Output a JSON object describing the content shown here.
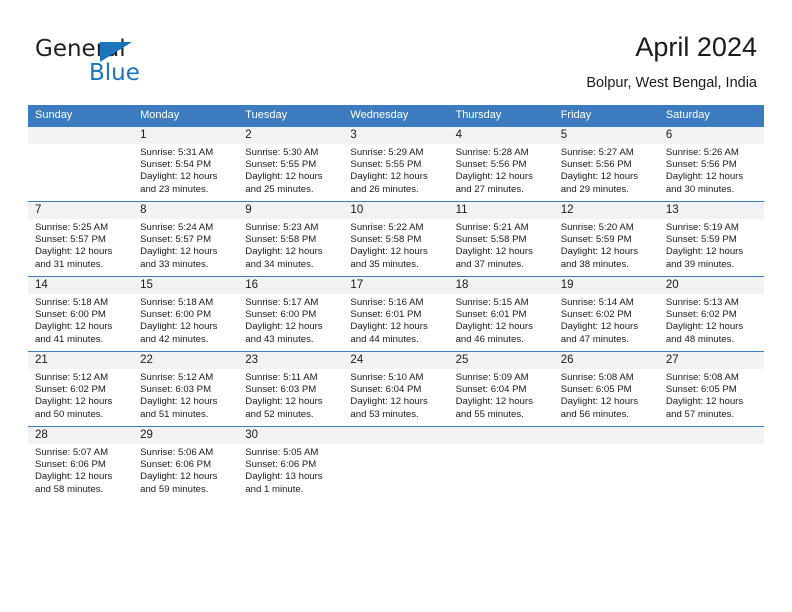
{
  "logo": {
    "word_one": "General",
    "word_two": "Blue",
    "triangle_color": "#1b75bb",
    "text_color": "#231f20"
  },
  "header": {
    "title": "April 2024",
    "subtitle": "Bolpur, West Bengal, India"
  },
  "theme": {
    "header_blue": "#3c7cbe",
    "daynum_band": "#f2f2f2",
    "text": "#1a1a1a"
  },
  "weekday_headers": [
    "Sunday",
    "Monday",
    "Tuesday",
    "Wednesday",
    "Thursday",
    "Friday",
    "Saturday"
  ],
  "labels": {
    "sunrise_prefix": "Sunrise:",
    "sunset_prefix": "Sunset:",
    "daylight_prefix": "Daylight:"
  },
  "weeks": [
    [
      {
        "day": "",
        "sunrise": "",
        "sunset": "",
        "daylight_line1": "",
        "daylight_line2": ""
      },
      {
        "day": "1",
        "sunrise": "Sunrise: 5:31 AM",
        "sunset": "Sunset: 5:54 PM",
        "daylight_line1": "Daylight: 12 hours",
        "daylight_line2": "and 23 minutes."
      },
      {
        "day": "2",
        "sunrise": "Sunrise: 5:30 AM",
        "sunset": "Sunset: 5:55 PM",
        "daylight_line1": "Daylight: 12 hours",
        "daylight_line2": "and 25 minutes."
      },
      {
        "day": "3",
        "sunrise": "Sunrise: 5:29 AM",
        "sunset": "Sunset: 5:55 PM",
        "daylight_line1": "Daylight: 12 hours",
        "daylight_line2": "and 26 minutes."
      },
      {
        "day": "4",
        "sunrise": "Sunrise: 5:28 AM",
        "sunset": "Sunset: 5:56 PM",
        "daylight_line1": "Daylight: 12 hours",
        "daylight_line2": "and 27 minutes."
      },
      {
        "day": "5",
        "sunrise": "Sunrise: 5:27 AM",
        "sunset": "Sunset: 5:56 PM",
        "daylight_line1": "Daylight: 12 hours",
        "daylight_line2": "and 29 minutes."
      },
      {
        "day": "6",
        "sunrise": "Sunrise: 5:26 AM",
        "sunset": "Sunset: 5:56 PM",
        "daylight_line1": "Daylight: 12 hours",
        "daylight_line2": "and 30 minutes."
      }
    ],
    [
      {
        "day": "7",
        "sunrise": "Sunrise: 5:25 AM",
        "sunset": "Sunset: 5:57 PM",
        "daylight_line1": "Daylight: 12 hours",
        "daylight_line2": "and 31 minutes."
      },
      {
        "day": "8",
        "sunrise": "Sunrise: 5:24 AM",
        "sunset": "Sunset: 5:57 PM",
        "daylight_line1": "Daylight: 12 hours",
        "daylight_line2": "and 33 minutes."
      },
      {
        "day": "9",
        "sunrise": "Sunrise: 5:23 AM",
        "sunset": "Sunset: 5:58 PM",
        "daylight_line1": "Daylight: 12 hours",
        "daylight_line2": "and 34 minutes."
      },
      {
        "day": "10",
        "sunrise": "Sunrise: 5:22 AM",
        "sunset": "Sunset: 5:58 PM",
        "daylight_line1": "Daylight: 12 hours",
        "daylight_line2": "and 35 minutes."
      },
      {
        "day": "11",
        "sunrise": "Sunrise: 5:21 AM",
        "sunset": "Sunset: 5:58 PM",
        "daylight_line1": "Daylight: 12 hours",
        "daylight_line2": "and 37 minutes."
      },
      {
        "day": "12",
        "sunrise": "Sunrise: 5:20 AM",
        "sunset": "Sunset: 5:59 PM",
        "daylight_line1": "Daylight: 12 hours",
        "daylight_line2": "and 38 minutes."
      },
      {
        "day": "13",
        "sunrise": "Sunrise: 5:19 AM",
        "sunset": "Sunset: 5:59 PM",
        "daylight_line1": "Daylight: 12 hours",
        "daylight_line2": "and 39 minutes."
      }
    ],
    [
      {
        "day": "14",
        "sunrise": "Sunrise: 5:18 AM",
        "sunset": "Sunset: 6:00 PM",
        "daylight_line1": "Daylight: 12 hours",
        "daylight_line2": "and 41 minutes."
      },
      {
        "day": "15",
        "sunrise": "Sunrise: 5:18 AM",
        "sunset": "Sunset: 6:00 PM",
        "daylight_line1": "Daylight: 12 hours",
        "daylight_line2": "and 42 minutes."
      },
      {
        "day": "16",
        "sunrise": "Sunrise: 5:17 AM",
        "sunset": "Sunset: 6:00 PM",
        "daylight_line1": "Daylight: 12 hours",
        "daylight_line2": "and 43 minutes."
      },
      {
        "day": "17",
        "sunrise": "Sunrise: 5:16 AM",
        "sunset": "Sunset: 6:01 PM",
        "daylight_line1": "Daylight: 12 hours",
        "daylight_line2": "and 44 minutes."
      },
      {
        "day": "18",
        "sunrise": "Sunrise: 5:15 AM",
        "sunset": "Sunset: 6:01 PM",
        "daylight_line1": "Daylight: 12 hours",
        "daylight_line2": "and 46 minutes."
      },
      {
        "day": "19",
        "sunrise": "Sunrise: 5:14 AM",
        "sunset": "Sunset: 6:02 PM",
        "daylight_line1": "Daylight: 12 hours",
        "daylight_line2": "and 47 minutes."
      },
      {
        "day": "20",
        "sunrise": "Sunrise: 5:13 AM",
        "sunset": "Sunset: 6:02 PM",
        "daylight_line1": "Daylight: 12 hours",
        "daylight_line2": "and 48 minutes."
      }
    ],
    [
      {
        "day": "21",
        "sunrise": "Sunrise: 5:12 AM",
        "sunset": "Sunset: 6:02 PM",
        "daylight_line1": "Daylight: 12 hours",
        "daylight_line2": "and 50 minutes."
      },
      {
        "day": "22",
        "sunrise": "Sunrise: 5:12 AM",
        "sunset": "Sunset: 6:03 PM",
        "daylight_line1": "Daylight: 12 hours",
        "daylight_line2": "and 51 minutes."
      },
      {
        "day": "23",
        "sunrise": "Sunrise: 5:11 AM",
        "sunset": "Sunset: 6:03 PM",
        "daylight_line1": "Daylight: 12 hours",
        "daylight_line2": "and 52 minutes."
      },
      {
        "day": "24",
        "sunrise": "Sunrise: 5:10 AM",
        "sunset": "Sunset: 6:04 PM",
        "daylight_line1": "Daylight: 12 hours",
        "daylight_line2": "and 53 minutes."
      },
      {
        "day": "25",
        "sunrise": "Sunrise: 5:09 AM",
        "sunset": "Sunset: 6:04 PM",
        "daylight_line1": "Daylight: 12 hours",
        "daylight_line2": "and 55 minutes."
      },
      {
        "day": "26",
        "sunrise": "Sunrise: 5:08 AM",
        "sunset": "Sunset: 6:05 PM",
        "daylight_line1": "Daylight: 12 hours",
        "daylight_line2": "and 56 minutes."
      },
      {
        "day": "27",
        "sunrise": "Sunrise: 5:08 AM",
        "sunset": "Sunset: 6:05 PM",
        "daylight_line1": "Daylight: 12 hours",
        "daylight_line2": "and 57 minutes."
      }
    ],
    [
      {
        "day": "28",
        "sunrise": "Sunrise: 5:07 AM",
        "sunset": "Sunset: 6:06 PM",
        "daylight_line1": "Daylight: 12 hours",
        "daylight_line2": "and 58 minutes."
      },
      {
        "day": "29",
        "sunrise": "Sunrise: 5:06 AM",
        "sunset": "Sunset: 6:06 PM",
        "daylight_line1": "Daylight: 12 hours",
        "daylight_line2": "and 59 minutes."
      },
      {
        "day": "30",
        "sunrise": "Sunrise: 5:05 AM",
        "sunset": "Sunset: 6:06 PM",
        "daylight_line1": "Daylight: 13 hours",
        "daylight_line2": "and 1 minute."
      },
      {
        "day": "",
        "sunrise": "",
        "sunset": "",
        "daylight_line1": "",
        "daylight_line2": ""
      },
      {
        "day": "",
        "sunrise": "",
        "sunset": "",
        "daylight_line1": "",
        "daylight_line2": ""
      },
      {
        "day": "",
        "sunrise": "",
        "sunset": "",
        "daylight_line1": "",
        "daylight_line2": ""
      },
      {
        "day": "",
        "sunrise": "",
        "sunset": "",
        "daylight_line1": "",
        "daylight_line2": ""
      }
    ]
  ]
}
